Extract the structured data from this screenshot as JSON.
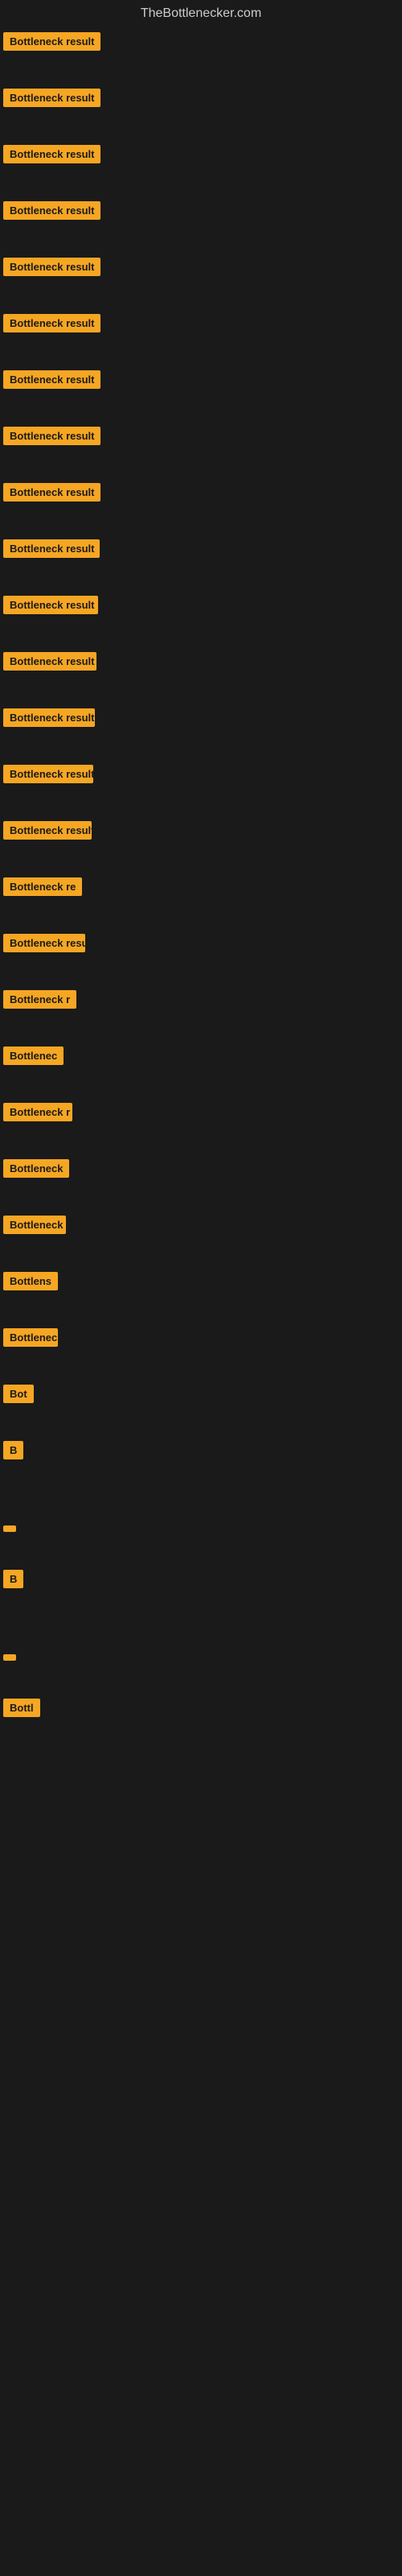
{
  "site": {
    "title": "TheBottlenecker.com"
  },
  "rows": [
    {
      "id": 1,
      "label": "Bottleneck result"
    },
    {
      "id": 2,
      "label": "Bottleneck result"
    },
    {
      "id": 3,
      "label": "Bottleneck result"
    },
    {
      "id": 4,
      "label": "Bottleneck result"
    },
    {
      "id": 5,
      "label": "Bottleneck result"
    },
    {
      "id": 6,
      "label": "Bottleneck result"
    },
    {
      "id": 7,
      "label": "Bottleneck result"
    },
    {
      "id": 8,
      "label": "Bottleneck result"
    },
    {
      "id": 9,
      "label": "Bottleneck result"
    },
    {
      "id": 10,
      "label": "Bottleneck result"
    },
    {
      "id": 11,
      "label": "Bottleneck result"
    },
    {
      "id": 12,
      "label": "Bottleneck result"
    },
    {
      "id": 13,
      "label": "Bottleneck result"
    },
    {
      "id": 14,
      "label": "Bottleneck result"
    },
    {
      "id": 15,
      "label": "Bottleneck result"
    },
    {
      "id": 16,
      "label": "Bottleneck re"
    },
    {
      "id": 17,
      "label": "Bottleneck result"
    },
    {
      "id": 18,
      "label": "Bottleneck r"
    },
    {
      "id": 19,
      "label": "Bottlenec"
    },
    {
      "id": 20,
      "label": "Bottleneck r"
    },
    {
      "id": 21,
      "label": "Bottleneck"
    },
    {
      "id": 22,
      "label": "Bottleneck res"
    },
    {
      "id": 23,
      "label": "Bottlens"
    },
    {
      "id": 24,
      "label": "Bottleneck"
    },
    {
      "id": 25,
      "label": "Bot"
    },
    {
      "id": 26,
      "label": "B"
    },
    {
      "id": 27,
      "label": ""
    },
    {
      "id": 28,
      "label": "B"
    },
    {
      "id": 29,
      "label": ""
    },
    {
      "id": 30,
      "label": "Bottl"
    }
  ]
}
